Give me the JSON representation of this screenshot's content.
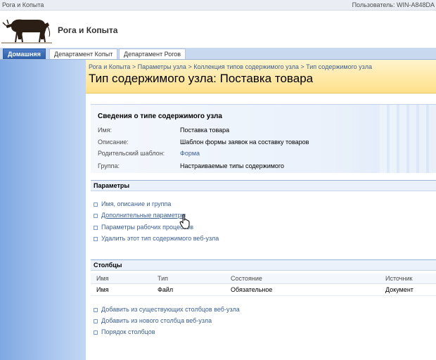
{
  "topbar": {
    "site": "Рога и Копыта",
    "user": "Пользователь: WIN-A848DA"
  },
  "banner": {
    "site_title": "Рога и Копыта",
    "logo_icon": "cow-logo-icon"
  },
  "tabs": [
    {
      "label": "Домашняя",
      "active": true
    },
    {
      "label": "Департамент Копыт",
      "active": false
    },
    {
      "label": "Департамент Рогов",
      "active": false
    }
  ],
  "breadcrumb": {
    "items": [
      "Рога и Копыта",
      "Параметры узла",
      "Коллекция типов содержимого узла",
      "Тип содержимого узла"
    ],
    "separator": ">"
  },
  "page_title": "Тип содержимого узла: Поставка товара",
  "info": {
    "heading": "Сведения о типе содержимого узла",
    "name_label": "Имя:",
    "name_value": "Поставка товара",
    "desc_label": "Описание:",
    "desc_value": "Шаблон формы заявок на составку товаров",
    "parent_label": "Родительский шаблон:",
    "parent_value": "Форма",
    "group_label": "Группа:",
    "group_value": "Настраиваемые типы содержимого"
  },
  "parameters": {
    "title": "Параметры",
    "links": [
      "Имя, описание и группа",
      "Дополнительные параметры",
      "Параметры рабочих процессов",
      "Удалить этот тип содержимого веб-узла"
    ]
  },
  "columns": {
    "title": "Столбцы",
    "headers": [
      "Имя",
      "Тип",
      "Состояние",
      "Источник"
    ],
    "rows": [
      [
        "Имя",
        "Файл",
        "Обязательное",
        "Документ"
      ]
    ],
    "links": [
      "Добавить из существующих столбцов веб-узла",
      "Добавить из нового столбца веб-узла",
      "Порядок столбцов"
    ]
  },
  "colors": {
    "accent": "#3b5f93",
    "title_bg": "#ffe08a",
    "nav_bg": "#7fa8e2",
    "tab_active": "#2e5ea8"
  }
}
